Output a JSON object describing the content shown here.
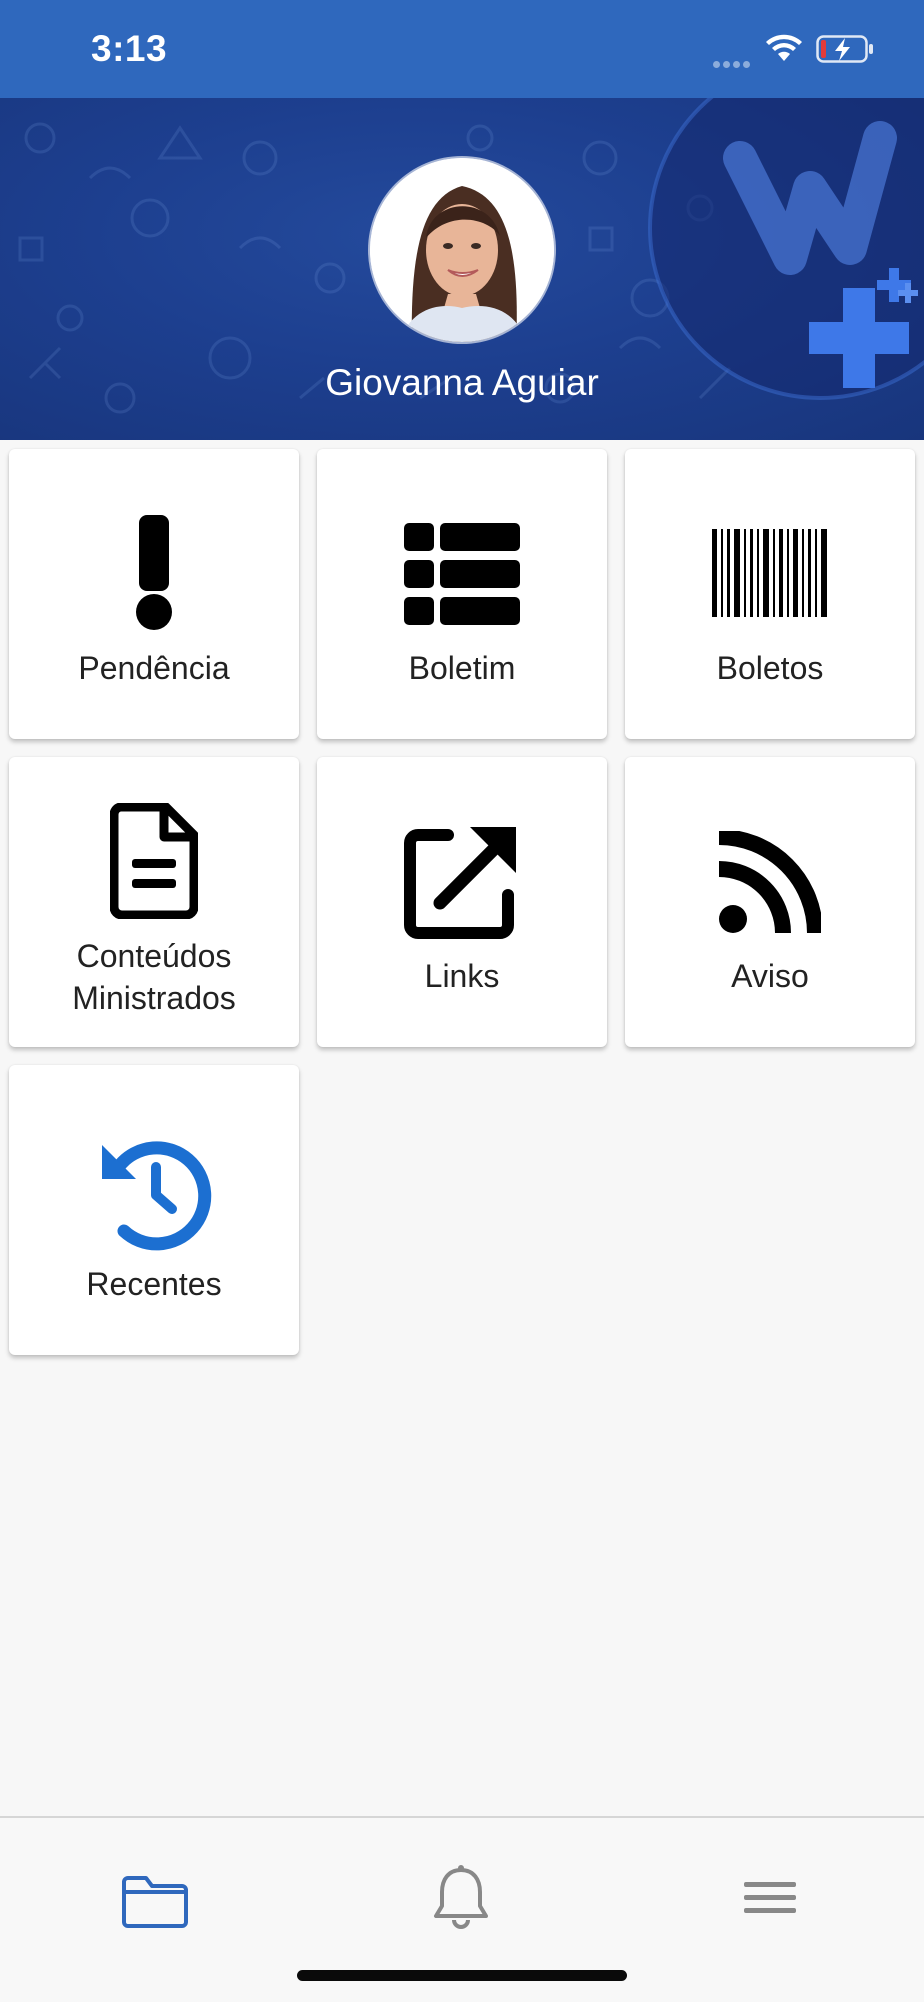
{
  "status_bar": {
    "time": "3:13"
  },
  "header": {
    "user_name": "Giovanna Aguiar"
  },
  "menu": {
    "items": [
      {
        "label": "Pendência",
        "icon": "exclamation-icon"
      },
      {
        "label": "Boletim",
        "icon": "list-icon"
      },
      {
        "label": "Boletos",
        "icon": "barcode-icon"
      },
      {
        "label": "Conteúdos Ministrados",
        "icon": "document-icon"
      },
      {
        "label": "Links",
        "icon": "external-link-icon"
      },
      {
        "label": "Aviso",
        "icon": "rss-icon"
      },
      {
        "label": "Recentes",
        "icon": "history-icon"
      }
    ]
  },
  "bottom_nav": {
    "items": [
      {
        "icon": "folder-icon",
        "active": true
      },
      {
        "icon": "bell-icon",
        "active": false
      },
      {
        "icon": "menu-icon",
        "active": false
      }
    ]
  },
  "colors": {
    "status_bar": "#2f68bd",
    "header_bg": "#1d3f8f",
    "accent_blue": "#1c6fd1",
    "icon_dark": "#000000",
    "nav_inactive": "#888888"
  }
}
